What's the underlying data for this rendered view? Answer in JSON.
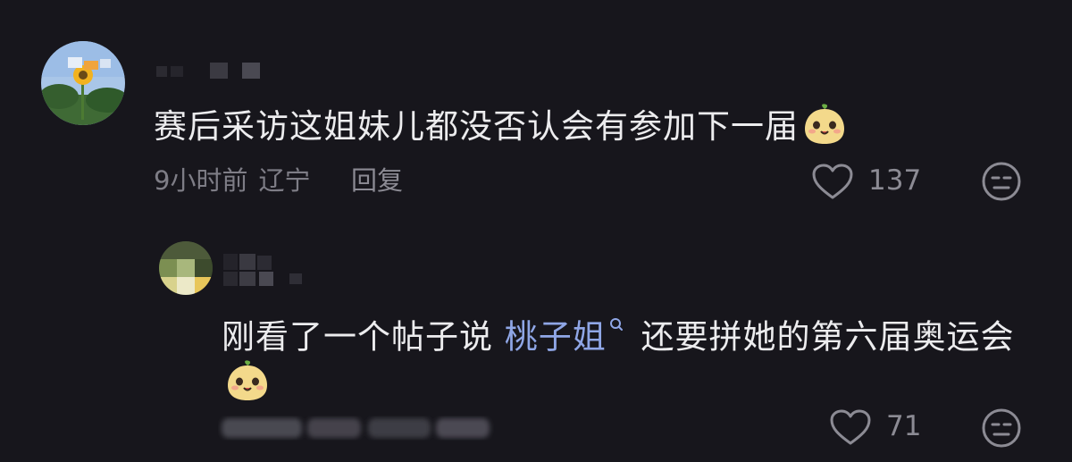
{
  "comments": [
    {
      "text": "赛后采访这姐妹儿都没否认会有参加下一届",
      "time": "9小时前",
      "location": "辽宁",
      "reply_label": "回复",
      "likes": "137",
      "emoji": "peach-face-emoji"
    },
    {
      "text_before": "刚看了一个帖子说 ",
      "link_text": "桃子姐",
      "text_after": " 还要拼她的第六届奥运会",
      "likes": "71",
      "emoji": "peach-face-emoji"
    }
  ],
  "colors": {
    "background": "#17161c",
    "text": "#ececee",
    "meta": "#7e7d86",
    "link": "#8fa6e6"
  },
  "icons": [
    "heart-outline-icon",
    "dislike-face-icon",
    "search-hint-icon"
  ]
}
